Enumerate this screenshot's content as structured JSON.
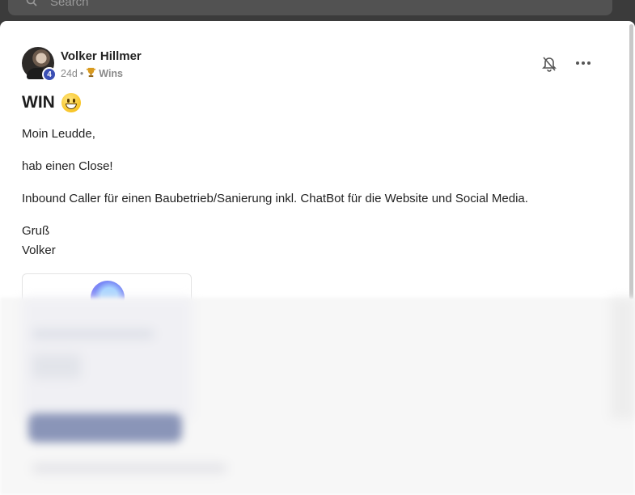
{
  "search": {
    "placeholder": "Search"
  },
  "post": {
    "author": {
      "name": "Volker Hillmer",
      "level": "4"
    },
    "age": "24d",
    "separator": "•",
    "category": "Wins",
    "title": "WIN",
    "paragraphs": [
      "Moin Leudde,",
      "hab einen Close!",
      "Inbound Caller für einen Baubetrieb/Sanierung inkl. ChatBot für die Website und Social Media.",
      "Gruß",
      "Volker"
    ]
  },
  "icons": {
    "search": "search-icon",
    "bell": "bell-off-icon",
    "more": "more-icon",
    "trophy": "trophy-icon",
    "emoji": "grinning-face-emoji"
  },
  "colors": {
    "level_badge": "#3b4fb4",
    "text": "#222222",
    "muted": "#8a8a8a"
  }
}
